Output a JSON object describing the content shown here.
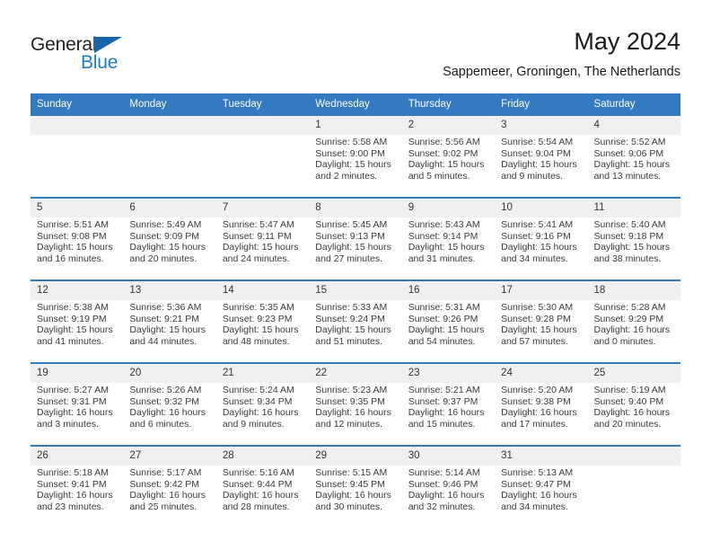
{
  "logo": {
    "word_one": "General",
    "word_two": "Blue",
    "triangle_icon": "triangle-icon",
    "colors": {
      "general": "#231f20",
      "blue": "#1f7cc4",
      "triangle": "#1565a8"
    }
  },
  "header": {
    "month_title": "May 2024",
    "location": "Sappemeer, Groningen, The Netherlands"
  },
  "theme": {
    "header_blue": "#337ac0",
    "daynum_gray": "#f0f0f0",
    "cell_white": "#ffffff",
    "text": "#3a3a3a"
  },
  "calendar": {
    "weekday_headers": [
      "Sunday",
      "Monday",
      "Tuesday",
      "Wednesday",
      "Thursday",
      "Friday",
      "Saturday"
    ],
    "weeks": [
      {
        "days": [
          {
            "num": "",
            "empty": true,
            "sunrise": "",
            "sunset": "",
            "daylight_line1": "",
            "daylight_line2": ""
          },
          {
            "num": "",
            "empty": true,
            "sunrise": "",
            "sunset": "",
            "daylight_line1": "",
            "daylight_line2": ""
          },
          {
            "num": "",
            "empty": true,
            "sunrise": "",
            "sunset": "",
            "daylight_line1": "",
            "daylight_line2": ""
          },
          {
            "num": "1",
            "empty": false,
            "sunrise": "Sunrise: 5:58 AM",
            "sunset": "Sunset: 9:00 PM",
            "daylight_line1": "Daylight: 15 hours",
            "daylight_line2": "and 2 minutes."
          },
          {
            "num": "2",
            "empty": false,
            "sunrise": "Sunrise: 5:56 AM",
            "sunset": "Sunset: 9:02 PM",
            "daylight_line1": "Daylight: 15 hours",
            "daylight_line2": "and 5 minutes."
          },
          {
            "num": "3",
            "empty": false,
            "sunrise": "Sunrise: 5:54 AM",
            "sunset": "Sunset: 9:04 PM",
            "daylight_line1": "Daylight: 15 hours",
            "daylight_line2": "and 9 minutes."
          },
          {
            "num": "4",
            "empty": false,
            "sunrise": "Sunrise: 5:52 AM",
            "sunset": "Sunset: 9:06 PM",
            "daylight_line1": "Daylight: 15 hours",
            "daylight_line2": "and 13 minutes."
          }
        ]
      },
      {
        "days": [
          {
            "num": "5",
            "empty": false,
            "sunrise": "Sunrise: 5:51 AM",
            "sunset": "Sunset: 9:08 PM",
            "daylight_line1": "Daylight: 15 hours",
            "daylight_line2": "and 16 minutes."
          },
          {
            "num": "6",
            "empty": false,
            "sunrise": "Sunrise: 5:49 AM",
            "sunset": "Sunset: 9:09 PM",
            "daylight_line1": "Daylight: 15 hours",
            "daylight_line2": "and 20 minutes."
          },
          {
            "num": "7",
            "empty": false,
            "sunrise": "Sunrise: 5:47 AM",
            "sunset": "Sunset: 9:11 PM",
            "daylight_line1": "Daylight: 15 hours",
            "daylight_line2": "and 24 minutes."
          },
          {
            "num": "8",
            "empty": false,
            "sunrise": "Sunrise: 5:45 AM",
            "sunset": "Sunset: 9:13 PM",
            "daylight_line1": "Daylight: 15 hours",
            "daylight_line2": "and 27 minutes."
          },
          {
            "num": "9",
            "empty": false,
            "sunrise": "Sunrise: 5:43 AM",
            "sunset": "Sunset: 9:14 PM",
            "daylight_line1": "Daylight: 15 hours",
            "daylight_line2": "and 31 minutes."
          },
          {
            "num": "10",
            "empty": false,
            "sunrise": "Sunrise: 5:41 AM",
            "sunset": "Sunset: 9:16 PM",
            "daylight_line1": "Daylight: 15 hours",
            "daylight_line2": "and 34 minutes."
          },
          {
            "num": "11",
            "empty": false,
            "sunrise": "Sunrise: 5:40 AM",
            "sunset": "Sunset: 9:18 PM",
            "daylight_line1": "Daylight: 15 hours",
            "daylight_line2": "and 38 minutes."
          }
        ]
      },
      {
        "days": [
          {
            "num": "12",
            "empty": false,
            "sunrise": "Sunrise: 5:38 AM",
            "sunset": "Sunset: 9:19 PM",
            "daylight_line1": "Daylight: 15 hours",
            "daylight_line2": "and 41 minutes."
          },
          {
            "num": "13",
            "empty": false,
            "sunrise": "Sunrise: 5:36 AM",
            "sunset": "Sunset: 9:21 PM",
            "daylight_line1": "Daylight: 15 hours",
            "daylight_line2": "and 44 minutes."
          },
          {
            "num": "14",
            "empty": false,
            "sunrise": "Sunrise: 5:35 AM",
            "sunset": "Sunset: 9:23 PM",
            "daylight_line1": "Daylight: 15 hours",
            "daylight_line2": "and 48 minutes."
          },
          {
            "num": "15",
            "empty": false,
            "sunrise": "Sunrise: 5:33 AM",
            "sunset": "Sunset: 9:24 PM",
            "daylight_line1": "Daylight: 15 hours",
            "daylight_line2": "and 51 minutes."
          },
          {
            "num": "16",
            "empty": false,
            "sunrise": "Sunrise: 5:31 AM",
            "sunset": "Sunset: 9:26 PM",
            "daylight_line1": "Daylight: 15 hours",
            "daylight_line2": "and 54 minutes."
          },
          {
            "num": "17",
            "empty": false,
            "sunrise": "Sunrise: 5:30 AM",
            "sunset": "Sunset: 9:28 PM",
            "daylight_line1": "Daylight: 15 hours",
            "daylight_line2": "and 57 minutes."
          },
          {
            "num": "18",
            "empty": false,
            "sunrise": "Sunrise: 5:28 AM",
            "sunset": "Sunset: 9:29 PM",
            "daylight_line1": "Daylight: 16 hours",
            "daylight_line2": "and 0 minutes."
          }
        ]
      },
      {
        "days": [
          {
            "num": "19",
            "empty": false,
            "sunrise": "Sunrise: 5:27 AM",
            "sunset": "Sunset: 9:31 PM",
            "daylight_line1": "Daylight: 16 hours",
            "daylight_line2": "and 3 minutes."
          },
          {
            "num": "20",
            "empty": false,
            "sunrise": "Sunrise: 5:26 AM",
            "sunset": "Sunset: 9:32 PM",
            "daylight_line1": "Daylight: 16 hours",
            "daylight_line2": "and 6 minutes."
          },
          {
            "num": "21",
            "empty": false,
            "sunrise": "Sunrise: 5:24 AM",
            "sunset": "Sunset: 9:34 PM",
            "daylight_line1": "Daylight: 16 hours",
            "daylight_line2": "and 9 minutes."
          },
          {
            "num": "22",
            "empty": false,
            "sunrise": "Sunrise: 5:23 AM",
            "sunset": "Sunset: 9:35 PM",
            "daylight_line1": "Daylight: 16 hours",
            "daylight_line2": "and 12 minutes."
          },
          {
            "num": "23",
            "empty": false,
            "sunrise": "Sunrise: 5:21 AM",
            "sunset": "Sunset: 9:37 PM",
            "daylight_line1": "Daylight: 16 hours",
            "daylight_line2": "and 15 minutes."
          },
          {
            "num": "24",
            "empty": false,
            "sunrise": "Sunrise: 5:20 AM",
            "sunset": "Sunset: 9:38 PM",
            "daylight_line1": "Daylight: 16 hours",
            "daylight_line2": "and 17 minutes."
          },
          {
            "num": "25",
            "empty": false,
            "sunrise": "Sunrise: 5:19 AM",
            "sunset": "Sunset: 9:40 PM",
            "daylight_line1": "Daylight: 16 hours",
            "daylight_line2": "and 20 minutes."
          }
        ]
      },
      {
        "days": [
          {
            "num": "26",
            "empty": false,
            "sunrise": "Sunrise: 5:18 AM",
            "sunset": "Sunset: 9:41 PM",
            "daylight_line1": "Daylight: 16 hours",
            "daylight_line2": "and 23 minutes."
          },
          {
            "num": "27",
            "empty": false,
            "sunrise": "Sunrise: 5:17 AM",
            "sunset": "Sunset: 9:42 PM",
            "daylight_line1": "Daylight: 16 hours",
            "daylight_line2": "and 25 minutes."
          },
          {
            "num": "28",
            "empty": false,
            "sunrise": "Sunrise: 5:16 AM",
            "sunset": "Sunset: 9:44 PM",
            "daylight_line1": "Daylight: 16 hours",
            "daylight_line2": "and 28 minutes."
          },
          {
            "num": "29",
            "empty": false,
            "sunrise": "Sunrise: 5:15 AM",
            "sunset": "Sunset: 9:45 PM",
            "daylight_line1": "Daylight: 16 hours",
            "daylight_line2": "and 30 minutes."
          },
          {
            "num": "30",
            "empty": false,
            "sunrise": "Sunrise: 5:14 AM",
            "sunset": "Sunset: 9:46 PM",
            "daylight_line1": "Daylight: 16 hours",
            "daylight_line2": "and 32 minutes."
          },
          {
            "num": "31",
            "empty": false,
            "sunrise": "Sunrise: 5:13 AM",
            "sunset": "Sunset: 9:47 PM",
            "daylight_line1": "Daylight: 16 hours",
            "daylight_line2": "and 34 minutes."
          },
          {
            "num": "",
            "empty": true,
            "sunrise": "",
            "sunset": "",
            "daylight_line1": "",
            "daylight_line2": ""
          }
        ]
      }
    ]
  }
}
